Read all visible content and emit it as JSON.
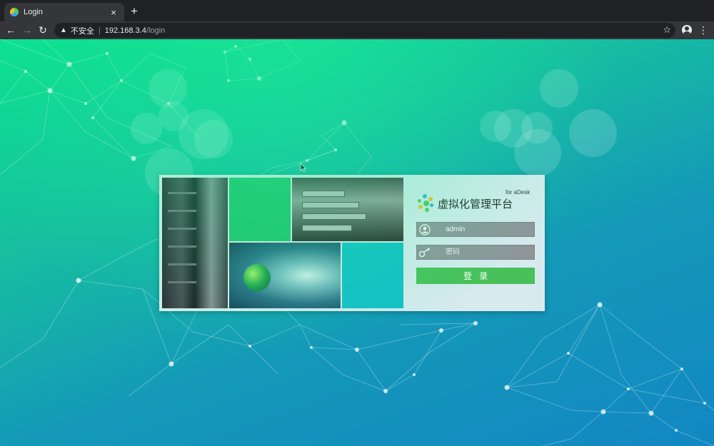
{
  "browser": {
    "tab_title": "Login",
    "tab_close": "×",
    "new_tab": "+",
    "security_label": "不安全",
    "url_host": "192.168.3.4",
    "url_path": "/login"
  },
  "login": {
    "brand_name": "虚拟化管理平台",
    "brand_sub": "for aDesk",
    "username_value": "admin",
    "password_placeholder": "密码",
    "submit_label": "登录"
  },
  "colors": {
    "accent_green": "#49c05a",
    "field_gray": "#8f9599",
    "tile_green": "#23c16e",
    "tile_teal": "#14bfc6"
  },
  "icons": [
    "back-arrow-icon",
    "forward-arrow-icon",
    "reload-icon",
    "warning-icon",
    "star-icon",
    "profile-icon",
    "kebab-menu-icon",
    "user-icon",
    "key-icon"
  ]
}
